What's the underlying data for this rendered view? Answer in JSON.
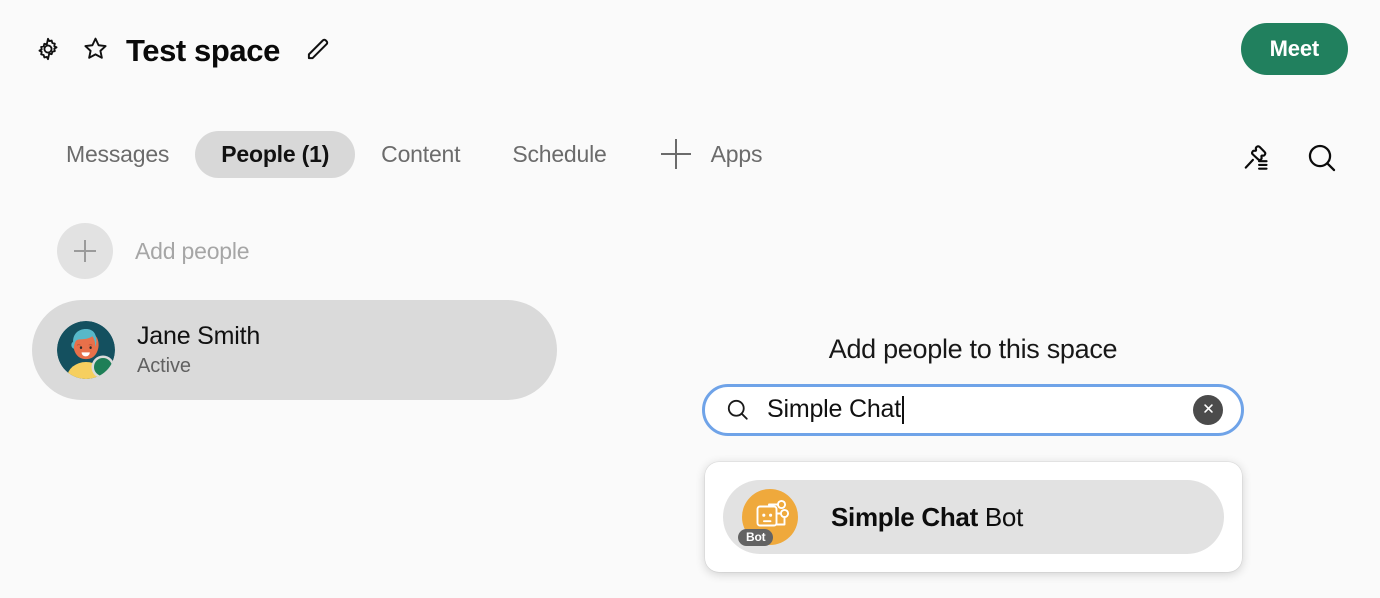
{
  "header": {
    "title": "Test space",
    "gear_icon": "gear-icon",
    "star_icon": "star-icon",
    "pencil_icon": "pencil-edit-icon",
    "meet_label": "Meet",
    "meet_color": "#21805e"
  },
  "tabbar": {
    "tabs": [
      {
        "label": "Messages",
        "active": false
      },
      {
        "label": "People (1)",
        "active": true
      },
      {
        "label": "Content",
        "active": false
      },
      {
        "label": "Schedule",
        "active": false
      }
    ],
    "apps_label": "Apps",
    "plus_icon": "plus-icon",
    "pin_icon": "pin-list-icon",
    "search_icon": "search-icon",
    "active_pill_color": "#d8d8d8"
  },
  "people": {
    "add_people_label": "Add people",
    "add_icon": "plus-icon",
    "members": [
      {
        "name": "Jane Smith",
        "status": "Active",
        "status_color": "#1e7f57",
        "avatar": "avatar-jane-smith"
      }
    ]
  },
  "add_panel": {
    "title": "Add people to this space",
    "search": {
      "value": "Simple Chat",
      "placeholder": "Search",
      "icon": "search-icon",
      "clear_icon": "clear-circle-icon",
      "focus_ring_color": "#6fa3e8"
    },
    "results": [
      {
        "name": "Simple Chat",
        "suffix": "Bot",
        "badge": "Bot",
        "avatar": "bot-avatar-simple-chat",
        "avatar_color": "#efa93c"
      }
    ]
  }
}
